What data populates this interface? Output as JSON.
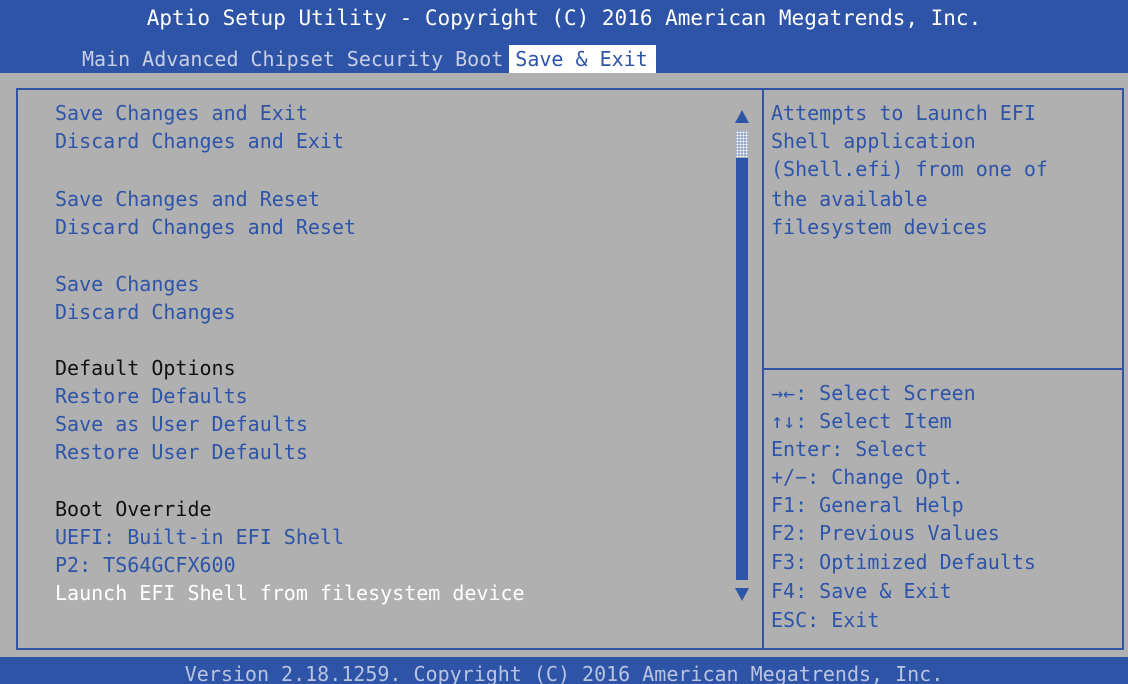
{
  "title": "Aptio Setup Utility - Copyright (C) 2016 American Megatrends, Inc.",
  "tabs": [
    {
      "label": "Main"
    },
    {
      "label": "Advanced"
    },
    {
      "label": "Chipset"
    },
    {
      "label": "Security"
    },
    {
      "label": "Boot"
    },
    {
      "label": "Save & Exit"
    }
  ],
  "active_tab": "Save & Exit",
  "menu": {
    "save_changes_and_exit": "Save Changes and Exit",
    "discard_changes_and_exit": "Discard Changes and Exit",
    "save_changes_and_reset": "Save Changes and Reset",
    "discard_changes_and_reset": "Discard Changes and Reset",
    "save_changes": "Save Changes",
    "discard_changes": "Discard Changes",
    "default_options_header": "Default Options",
    "restore_defaults": "Restore Defaults",
    "save_as_user_defaults": "Save as User Defaults",
    "restore_user_defaults": "Restore User Defaults",
    "boot_override_header": "Boot Override",
    "uefi_builtin_shell": "UEFI: Built-in EFI Shell",
    "p2_device": "P2: TS64GCFX600",
    "launch_efi_shell": "Launch EFI Shell from filesystem device"
  },
  "selected_item": "Launch EFI Shell from filesystem device",
  "help_text": [
    "Attempts to Launch EFI",
    "Shell application",
    "(Shell.efi) from one of",
    "the available",
    "filesystem devices"
  ],
  "key_help": [
    "→←: Select Screen",
    "↑↓: Select Item",
    "Enter: Select",
    "+/−: Change Opt.",
    "F1: General Help",
    "F2: Previous Values",
    "F3: Optimized Defaults",
    "F4: Save & Exit",
    "ESC: Exit"
  ],
  "footer": "Version 2.18.1259. Copyright (C) 2016 American Megatrends, Inc.",
  "colors": {
    "accent_blue": "#2e54a8",
    "panel_gray": "#b0b0b0",
    "selected_text": "#ffffff"
  }
}
